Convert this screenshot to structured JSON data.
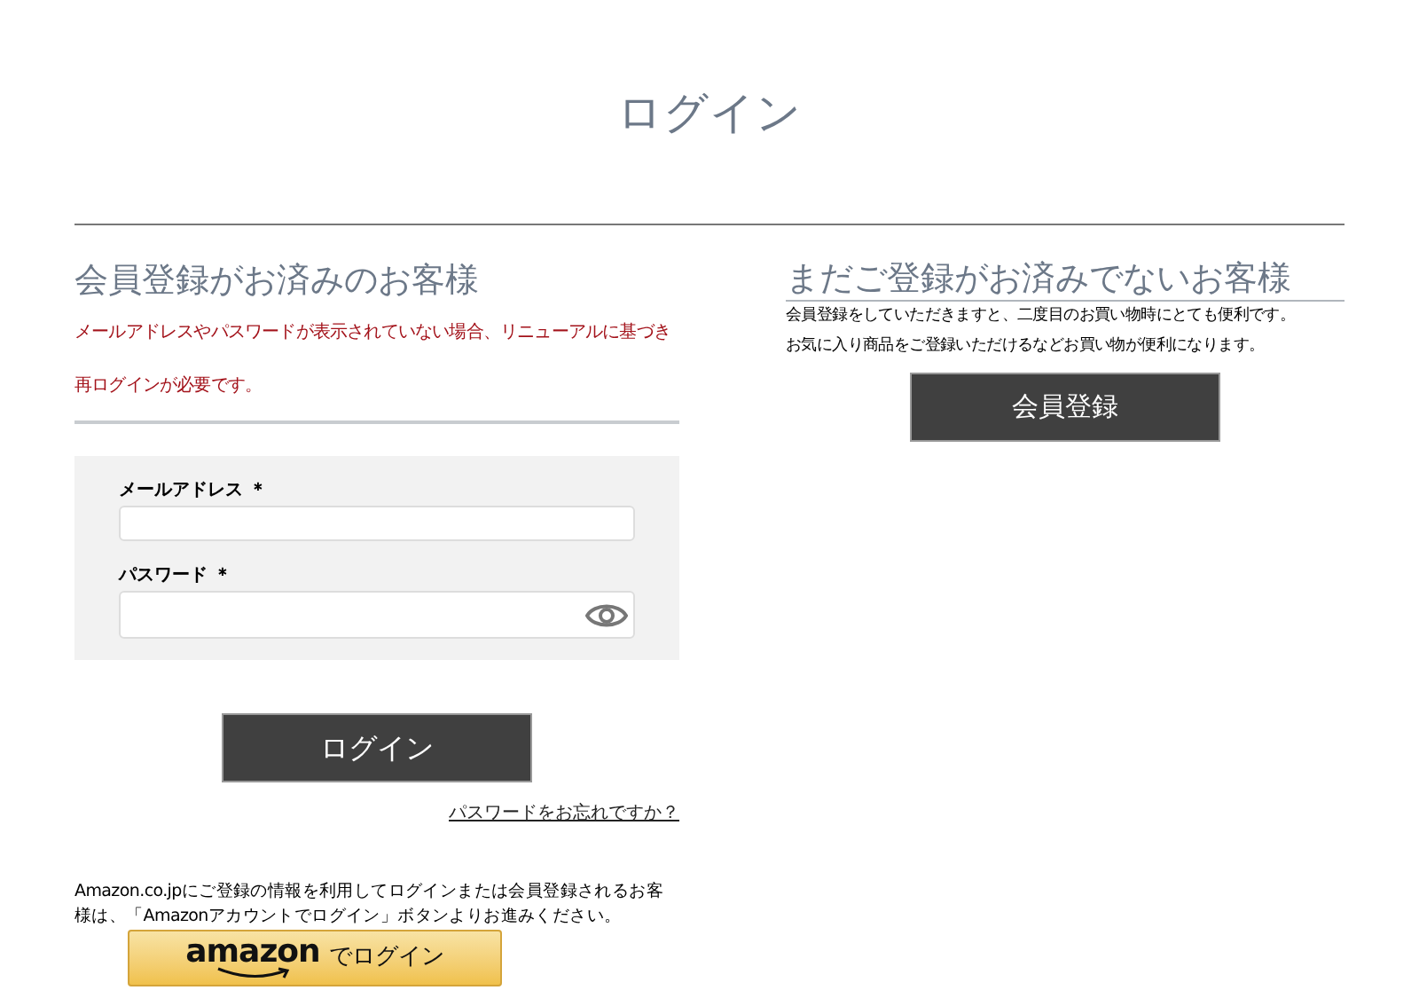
{
  "page_title": "ログイン",
  "member": {
    "heading": "会員登録がお済みのお客様",
    "notice": "メールアドレスやパスワードが表示されていない場合、リニューアルに基づき再ログインが必要です。",
    "fields": [
      {
        "label": "メールアドレス",
        "required_mark": "＊",
        "kind": "text"
      },
      {
        "label": "パスワード",
        "required_mark": "＊",
        "kind": "password"
      }
    ],
    "login_button": "ログイン",
    "forgot_link": "パスワードをお忘れですか？",
    "amazon_note": "Amazon.co.jpにご登録の情報を利用してログインまたは会員登録されるお客様は、「Amazonアカウントでログイン」ボタンよりお進みください。",
    "amazon_button": {
      "logo_text": "amazon",
      "label": "でログイン"
    }
  },
  "guest": {
    "heading": "まだご登録がお済みでないお客様",
    "lines": [
      "会員登録をしていただきますと、二度目のお買い物時にとても便利です。",
      "お気に入り商品をご登録いただけるなどお買い物が便利になります。"
    ],
    "register_button": "会員登録"
  }
}
